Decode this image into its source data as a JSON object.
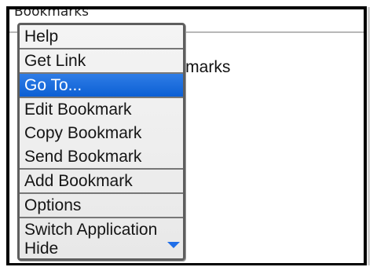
{
  "app": {
    "title": "Bookmarks"
  },
  "content": {
    "items": [
      "s",
      "okmarks"
    ]
  },
  "menu": {
    "items": [
      {
        "label": "Help",
        "selected": false
      },
      {
        "label": "Get Link",
        "selected": false
      },
      {
        "label": "Go To...",
        "selected": true
      },
      {
        "label": "Edit Bookmark",
        "selected": false
      },
      {
        "label": "Copy Bookmark",
        "selected": false
      },
      {
        "label": "Send Bookmark",
        "selected": false
      },
      {
        "label": "Add Bookmark",
        "selected": false
      },
      {
        "label": "Options",
        "selected": false
      },
      {
        "label": "Switch Application",
        "selected": false
      },
      {
        "label": "Hide",
        "selected": false
      }
    ],
    "scroll_icon": "chevron-down-icon"
  },
  "colors": {
    "selection": "#1767dc",
    "frame": "#000000",
    "menu_border": "#5e5e5e"
  }
}
